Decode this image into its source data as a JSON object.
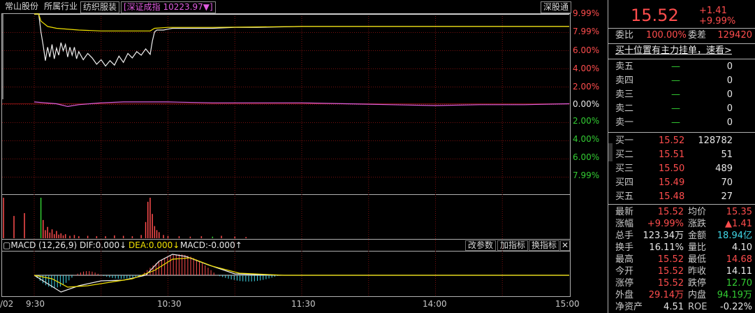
{
  "header": {
    "stock_name": "常山股份",
    "industry_label": "所属行业",
    "industry_value": "纺织服装",
    "index_text": "[深证成指 10223.97▼]",
    "exchange_button": "深股通"
  },
  "price_axis": {
    "left_top": [
      "9.99%",
      "7.99%",
      "6.00%",
      "4.00%",
      "2.00%"
    ],
    "zero": "0.00%",
    "left_bottom": [
      "2.00%",
      "4.00%",
      "6.00%",
      "7.99%"
    ]
  },
  "chart_data": {
    "type": "line",
    "x_ticks": [
      "9:30",
      "10:30",
      "11:30",
      "14:00",
      "15:00"
    ],
    "x_axis_partial_label": "/02",
    "y_ticks": [
      "9.99%",
      "7.99%",
      "6.00%",
      "4.00%",
      "2.00%",
      "0.00%",
      "2.00%",
      "4.00%",
      "6.00%",
      "7.99%"
    ],
    "ylim_pct": [
      -9.99,
      9.99
    ],
    "series": [],
    "price_line_pct": [
      [
        0,
        9.99
      ],
      [
        2,
        9.99
      ],
      [
        3,
        8.0
      ],
      [
        4,
        6.5
      ],
      [
        5,
        4.8
      ],
      [
        6,
        6.3
      ],
      [
        7,
        5.2
      ],
      [
        8,
        6.6
      ],
      [
        9,
        5.0
      ],
      [
        10,
        6.2
      ],
      [
        11,
        5.4
      ],
      [
        12,
        6.8
      ],
      [
        13,
        5.9
      ],
      [
        14,
        6.6
      ],
      [
        15,
        5.2
      ],
      [
        16,
        6.3
      ],
      [
        17,
        5.4
      ],
      [
        18,
        6.3
      ],
      [
        19,
        5.0
      ],
      [
        20,
        5.8
      ],
      [
        22,
        4.9
      ],
      [
        24,
        5.6
      ],
      [
        26,
        5.1
      ],
      [
        28,
        4.4
      ],
      [
        30,
        4.9
      ],
      [
        32,
        4.2
      ],
      [
        34,
        4.8
      ],
      [
        36,
        4.3
      ],
      [
        38,
        5.3
      ],
      [
        40,
        4.6
      ],
      [
        42,
        5.6
      ],
      [
        44,
        5.1
      ],
      [
        46,
        5.8
      ],
      [
        48,
        5.4
      ],
      [
        50,
        6.1
      ],
      [
        52,
        5.5
      ],
      [
        53,
        7.0
      ],
      [
        54,
        8.0
      ],
      [
        55,
        8.2
      ],
      [
        58,
        8.2
      ],
      [
        60,
        8.3
      ],
      [
        62,
        8.4
      ],
      [
        70,
        8.4
      ],
      [
        80,
        8.4
      ],
      [
        90,
        8.5
      ],
      [
        100,
        8.5
      ],
      [
        120,
        8.6
      ],
      [
        140,
        8.6
      ],
      [
        160,
        8.6
      ],
      [
        200,
        8.6
      ],
      [
        240,
        8.6
      ]
    ],
    "avg_line_pct": [
      [
        0,
        9.99
      ],
      [
        2,
        9.99
      ],
      [
        3,
        9.2
      ],
      [
        6,
        8.6
      ],
      [
        10,
        8.4
      ],
      [
        20,
        8.2
      ],
      [
        30,
        8.1
      ],
      [
        40,
        8.1
      ],
      [
        52,
        8.1
      ],
      [
        54,
        8.4
      ],
      [
        60,
        8.5
      ],
      [
        80,
        8.5
      ],
      [
        120,
        8.6
      ],
      [
        160,
        8.6
      ],
      [
        200,
        8.6
      ],
      [
        240,
        8.6
      ]
    ],
    "index_line_pct": [
      [
        0,
        0.2
      ],
      [
        5,
        0.1
      ],
      [
        10,
        0.0
      ],
      [
        15,
        -0.3
      ],
      [
        20,
        -0.1
      ],
      [
        30,
        0.1
      ],
      [
        40,
        0.2
      ],
      [
        60,
        0.2
      ],
      [
        80,
        0.1
      ],
      [
        100,
        0.1
      ],
      [
        120,
        0.1
      ],
      [
        140,
        0.0
      ],
      [
        160,
        -0.1
      ],
      [
        180,
        -0.2
      ],
      [
        200,
        -0.1
      ],
      [
        220,
        -0.1
      ],
      [
        240,
        0.0
      ]
    ],
    "volume": [
      [
        0,
        1.0,
        "r"
      ],
      [
        1,
        0.55,
        "r"
      ],
      [
        2,
        0.62,
        "r"
      ],
      [
        3,
        1.0,
        "g"
      ],
      [
        4,
        0.45,
        "r"
      ],
      [
        5,
        0.2,
        "r"
      ],
      [
        6,
        0.28,
        "r"
      ],
      [
        7,
        0.14,
        "r"
      ],
      [
        8,
        0.22,
        "r"
      ],
      [
        9,
        0.1,
        "r"
      ],
      [
        10,
        0.18,
        "r"
      ],
      [
        11,
        0.09,
        "r"
      ],
      [
        12,
        0.12,
        "r"
      ],
      [
        13,
        0.07,
        "r"
      ],
      [
        14,
        0.1,
        "r"
      ],
      [
        16,
        0.06,
        "r"
      ],
      [
        18,
        0.08,
        "r"
      ],
      [
        20,
        0.05,
        "r"
      ],
      [
        24,
        0.06,
        "r"
      ],
      [
        28,
        0.05,
        "r"
      ],
      [
        32,
        0.05,
        "r"
      ],
      [
        36,
        0.07,
        "r"
      ],
      [
        40,
        0.06,
        "r"
      ],
      [
        44,
        0.05,
        "r"
      ],
      [
        48,
        0.08,
        "r"
      ],
      [
        50,
        0.4,
        "r"
      ],
      [
        51,
        0.9,
        "r"
      ],
      [
        52,
        1.0,
        "r"
      ],
      [
        53,
        0.6,
        "r"
      ],
      [
        54,
        0.3,
        "r"
      ],
      [
        55,
        0.2,
        "r"
      ],
      [
        56,
        0.15,
        "r"
      ],
      [
        58,
        0.08,
        "r"
      ],
      [
        60,
        0.06,
        "r"
      ],
      [
        65,
        0.05,
        "r"
      ],
      [
        70,
        0.04,
        "r"
      ],
      [
        75,
        0.05,
        "r"
      ],
      [
        80,
        0.04,
        "g"
      ],
      [
        84,
        0.06,
        "r"
      ],
      [
        90,
        0.04,
        "r"
      ],
      [
        95,
        0.03,
        "r"
      ]
    ],
    "macd_label": "MACD",
    "macd_params": "(12,26,9)",
    "dif_text": "DIF:0.000↓",
    "dea_text": "DEA:0.000↓",
    "macd_text": "MACD:-0.000↑"
  },
  "macd_buttons": [
    "改参数",
    "加指标",
    "换指标"
  ],
  "quote": {
    "price": "15.52",
    "change": "+1.41",
    "change_pct": "+9.99%",
    "webi_label": "委比",
    "webi_value": "100.00%",
    "weicha_label": "委差",
    "weicha_value": "129420",
    "banner": "买十位置有主力挂单，速看",
    "sell": [
      {
        "label": "卖五",
        "price": "—",
        "vol": "0"
      },
      {
        "label": "卖四",
        "price": "—",
        "vol": "0"
      },
      {
        "label": "卖三",
        "price": "—",
        "vol": "0"
      },
      {
        "label": "卖二",
        "price": "—",
        "vol": "0"
      },
      {
        "label": "卖一",
        "price": "—",
        "vol": "0"
      }
    ],
    "buy": [
      {
        "label": "买一",
        "price": "15.52",
        "vol": "128782"
      },
      {
        "label": "买二",
        "price": "15.51",
        "vol": "51"
      },
      {
        "label": "买三",
        "price": "15.50",
        "vol": "489"
      },
      {
        "label": "买四",
        "price": "15.49",
        "vol": "70"
      },
      {
        "label": "买五",
        "price": "15.48",
        "vol": "27"
      }
    ],
    "stats": [
      {
        "l1": "最新",
        "v1": "15.52",
        "c1": "red",
        "l2": "均价",
        "v2": "15.35",
        "c2": "red"
      },
      {
        "l1": "涨幅",
        "v1": "+9.99%",
        "c1": "red",
        "l2": "涨跌",
        "v2": "▲1.41",
        "c2": "red"
      },
      {
        "l1": "总手",
        "v1": "123.34万",
        "c1": "white",
        "l2": "金额",
        "v2": "18.94亿",
        "c2": "cyan"
      },
      {
        "l1": "换手",
        "v1": "16.11%",
        "c1": "white",
        "l2": "量比",
        "v2": "4.10",
        "c2": "white"
      },
      {
        "l1": "最高",
        "v1": "15.52",
        "c1": "red",
        "l2": "最低",
        "v2": "14.68",
        "c2": "red"
      },
      {
        "l1": "今开",
        "v1": "15.52",
        "c1": "red",
        "l2": "昨收",
        "v2": "14.11",
        "c2": "white"
      },
      {
        "l1": "涨停",
        "v1": "15.52",
        "c1": "red",
        "l2": "跌停",
        "v2": "12.70",
        "c2": "green"
      },
      {
        "l1": "外盘",
        "v1": "29.14万",
        "c1": "red",
        "l2": "内盘",
        "v2": "94.19万",
        "c2": "green"
      },
      {
        "l1": "净资产",
        "v1": "4.51",
        "c1": "white",
        "l2": "ROE",
        "v2": "-0.22%",
        "c2": "white"
      }
    ]
  },
  "colors": {
    "up": "#ff4d4d",
    "down": "#33cc33",
    "avg_line": "#f0e000",
    "index_line": "#e060e0",
    "grid": "#7a1010"
  }
}
